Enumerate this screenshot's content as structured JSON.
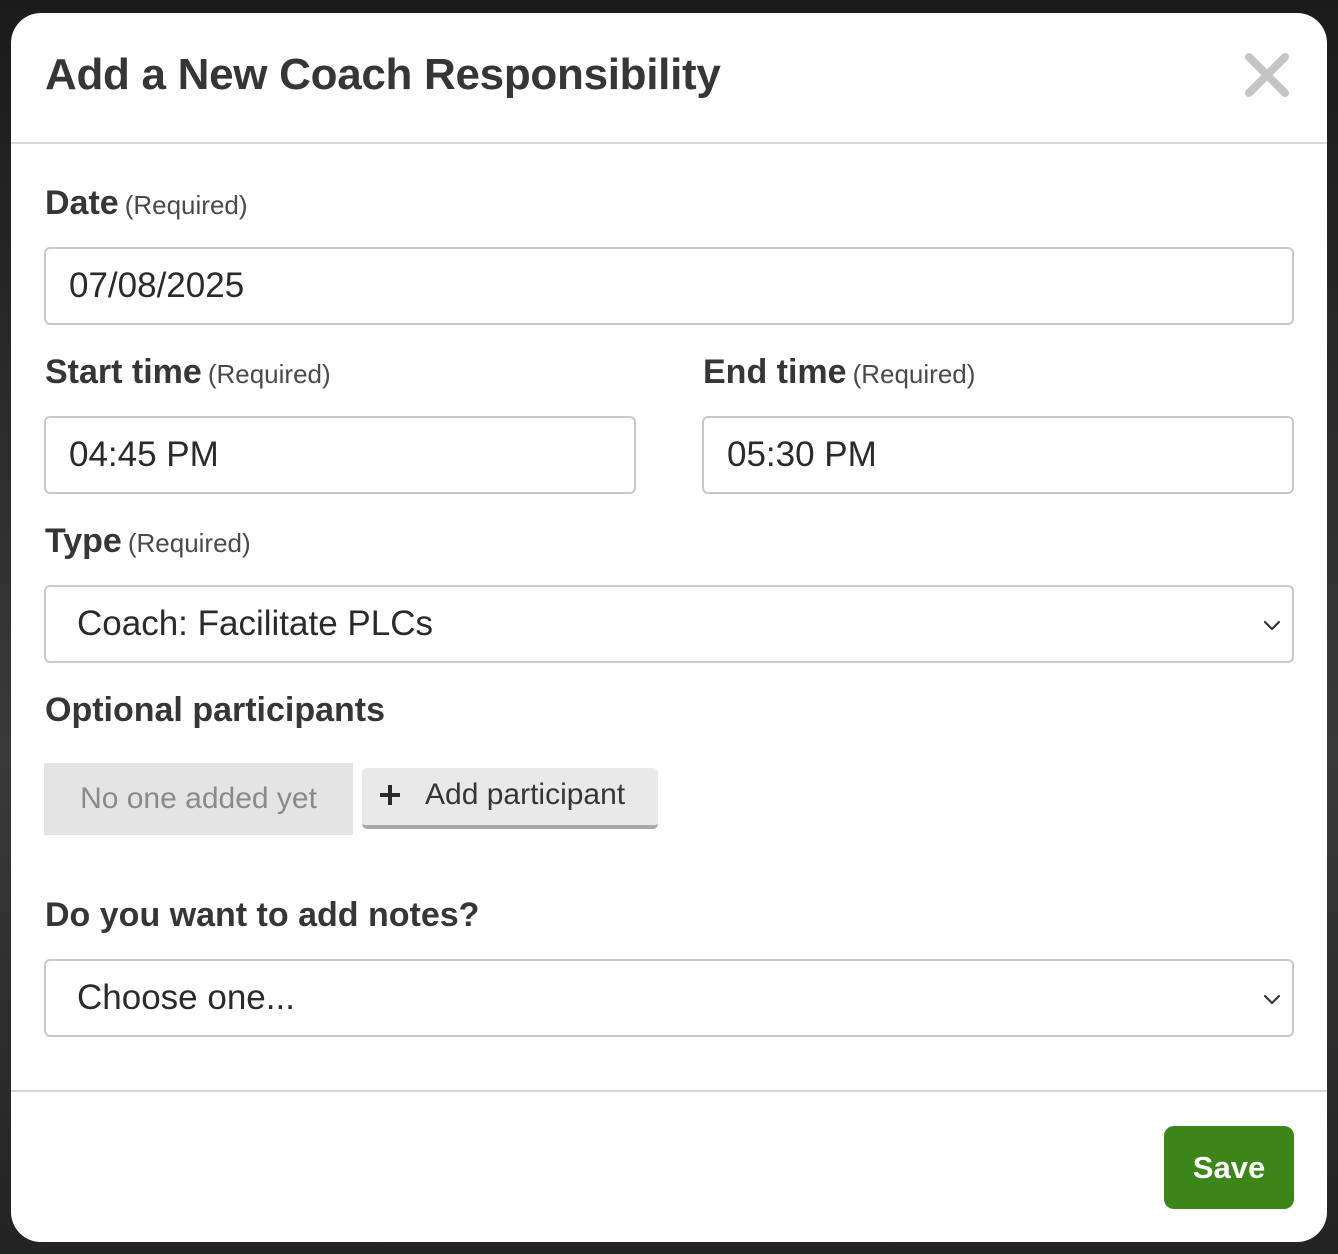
{
  "modal": {
    "title": "Add a New Coach Responsibility"
  },
  "icons": {
    "close": "close-icon",
    "chevron": "chevron-down-icon",
    "plus": "plus-icon"
  },
  "form": {
    "date": {
      "label": "Date",
      "required": "(Required)",
      "value": "07/08/2025"
    },
    "start_time": {
      "label": "Start time",
      "required": "(Required)",
      "value": "04:45 PM"
    },
    "end_time": {
      "label": "End time",
      "required": "(Required)",
      "value": "05:30 PM"
    },
    "type": {
      "label": "Type",
      "required": "(Required)",
      "selected": "Coach: Facilitate PLCs"
    },
    "participants": {
      "label": "Optional participants",
      "empty_text": "No one added yet",
      "add_label": "Add participant"
    },
    "notes": {
      "label": "Do you want to add notes?",
      "selected": "Choose one..."
    }
  },
  "footer": {
    "save_label": "Save"
  },
  "colors": {
    "save": "#3b8519",
    "text": "#363636",
    "border": "#c8c8c8"
  }
}
